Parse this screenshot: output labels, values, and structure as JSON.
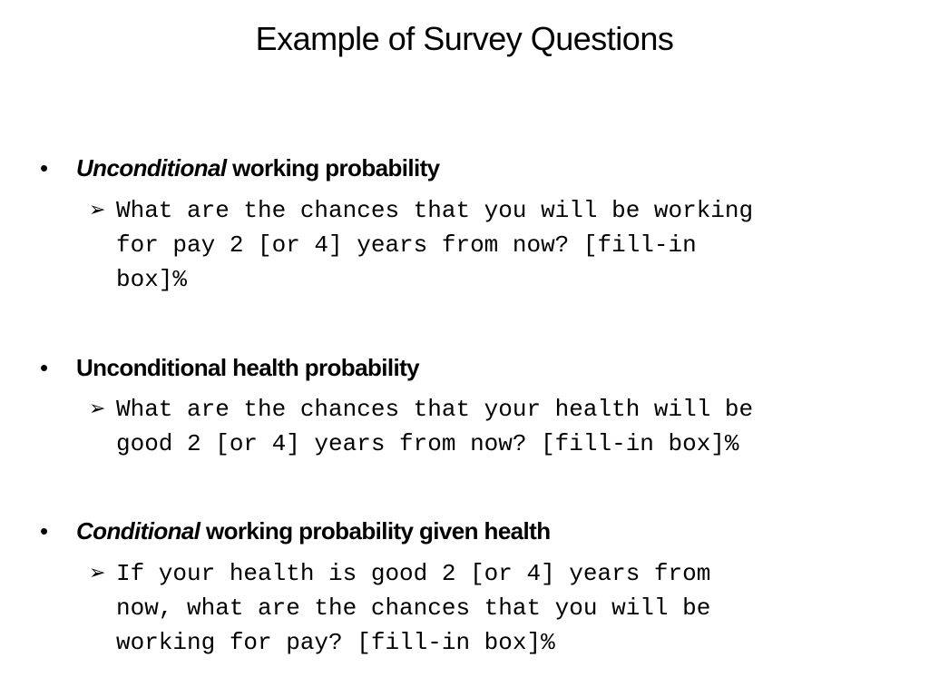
{
  "title": "Example of Survey Questions",
  "items": [
    {
      "head_italic": "Unconditional",
      "head_rest": " working probability",
      "question": "What are the chances that you will be working\nfor pay 2 [or 4] years from now? [fill-in\nbox]%"
    },
    {
      "head_italic": "",
      "head_rest": "Unconditional health probability",
      "question": "What are the chances that your health will be\ngood 2 [or 4] years from now? [fill-in box]%"
    },
    {
      "head_italic": "Conditional",
      "head_rest": " working probability given health",
      "question": "If your health is good 2 [or 4] years from\nnow, what are the chances that you will be\nworking for pay? [fill-in box]%"
    }
  ],
  "icons": {
    "bullet": "•",
    "arrow": "➢"
  }
}
